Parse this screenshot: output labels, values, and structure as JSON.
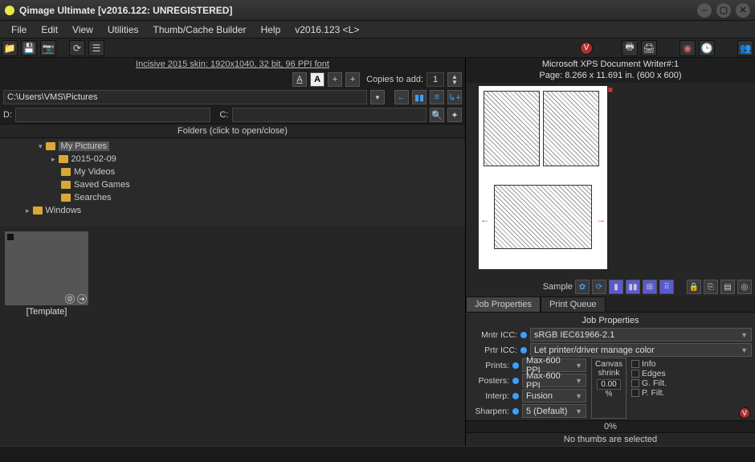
{
  "window": {
    "title": "Qimage Ultimate [v2016.122: UNREGISTERED]"
  },
  "menu": [
    "File",
    "Edit",
    "View",
    "Utilities",
    "Thumb/Cache Builder",
    "Help",
    "v2016.123 <L>"
  ],
  "skin_line": "Incisive 2015 skin: 1920x1040, 32 bit, 96 PPI font",
  "copies": {
    "label": "Copies to add:",
    "value": "1"
  },
  "path": {
    "value": "C:\\Users\\VMS\\Pictures"
  },
  "drives": {
    "d_label": "D:",
    "d_value": "",
    "c_label": "C:",
    "c_value": ""
  },
  "folders_header": "Folders (click to open/close)",
  "tree": [
    {
      "label": "My Pictures",
      "indent": 3,
      "sel": true,
      "exp": "down"
    },
    {
      "label": "2015-02-09",
      "indent": 4,
      "exp": "right"
    },
    {
      "label": "My Videos",
      "indent": 4
    },
    {
      "label": "Saved Games",
      "indent": 4
    },
    {
      "label": "Searches",
      "indent": 4
    },
    {
      "label": "Windows",
      "indent": 2,
      "exp": "right"
    }
  ],
  "template_label": "[Template]",
  "printer_line": "Microsoft XPS Document Writer#:1",
  "page_line": "Page: 8.266 x 11.691 in.  (600 x 600)",
  "sample_label": "Sample",
  "tabs": {
    "job": "Job Properties",
    "queue": "Print Queue"
  },
  "job_properties": {
    "title": "Job Properties",
    "mntr_label": "Mntr ICC:",
    "mntr_value": "sRGB IEC61966-2.1",
    "prtr_label": "Prtr ICC:",
    "prtr_value": "Let printer/driver manage color",
    "prints_label": "Prints:",
    "prints_value": "Max-600 PPI",
    "posters_label": "Posters:",
    "posters_value": "Max-600 PPI",
    "interp_label": "Interp:",
    "interp_value": "Fusion",
    "sharpen_label": "Sharpen:",
    "sharpen_value": "5 (Default)",
    "canvas_label": "Canvas shrink",
    "canvas_value": "0.00",
    "canvas_unit": "%",
    "chk_info": "Info",
    "chk_edges": "Edges",
    "chk_gfilt": "G. Filt.",
    "chk_pfilt": "P. Filt."
  },
  "percent": "0%",
  "status": "No thumbs are selected"
}
